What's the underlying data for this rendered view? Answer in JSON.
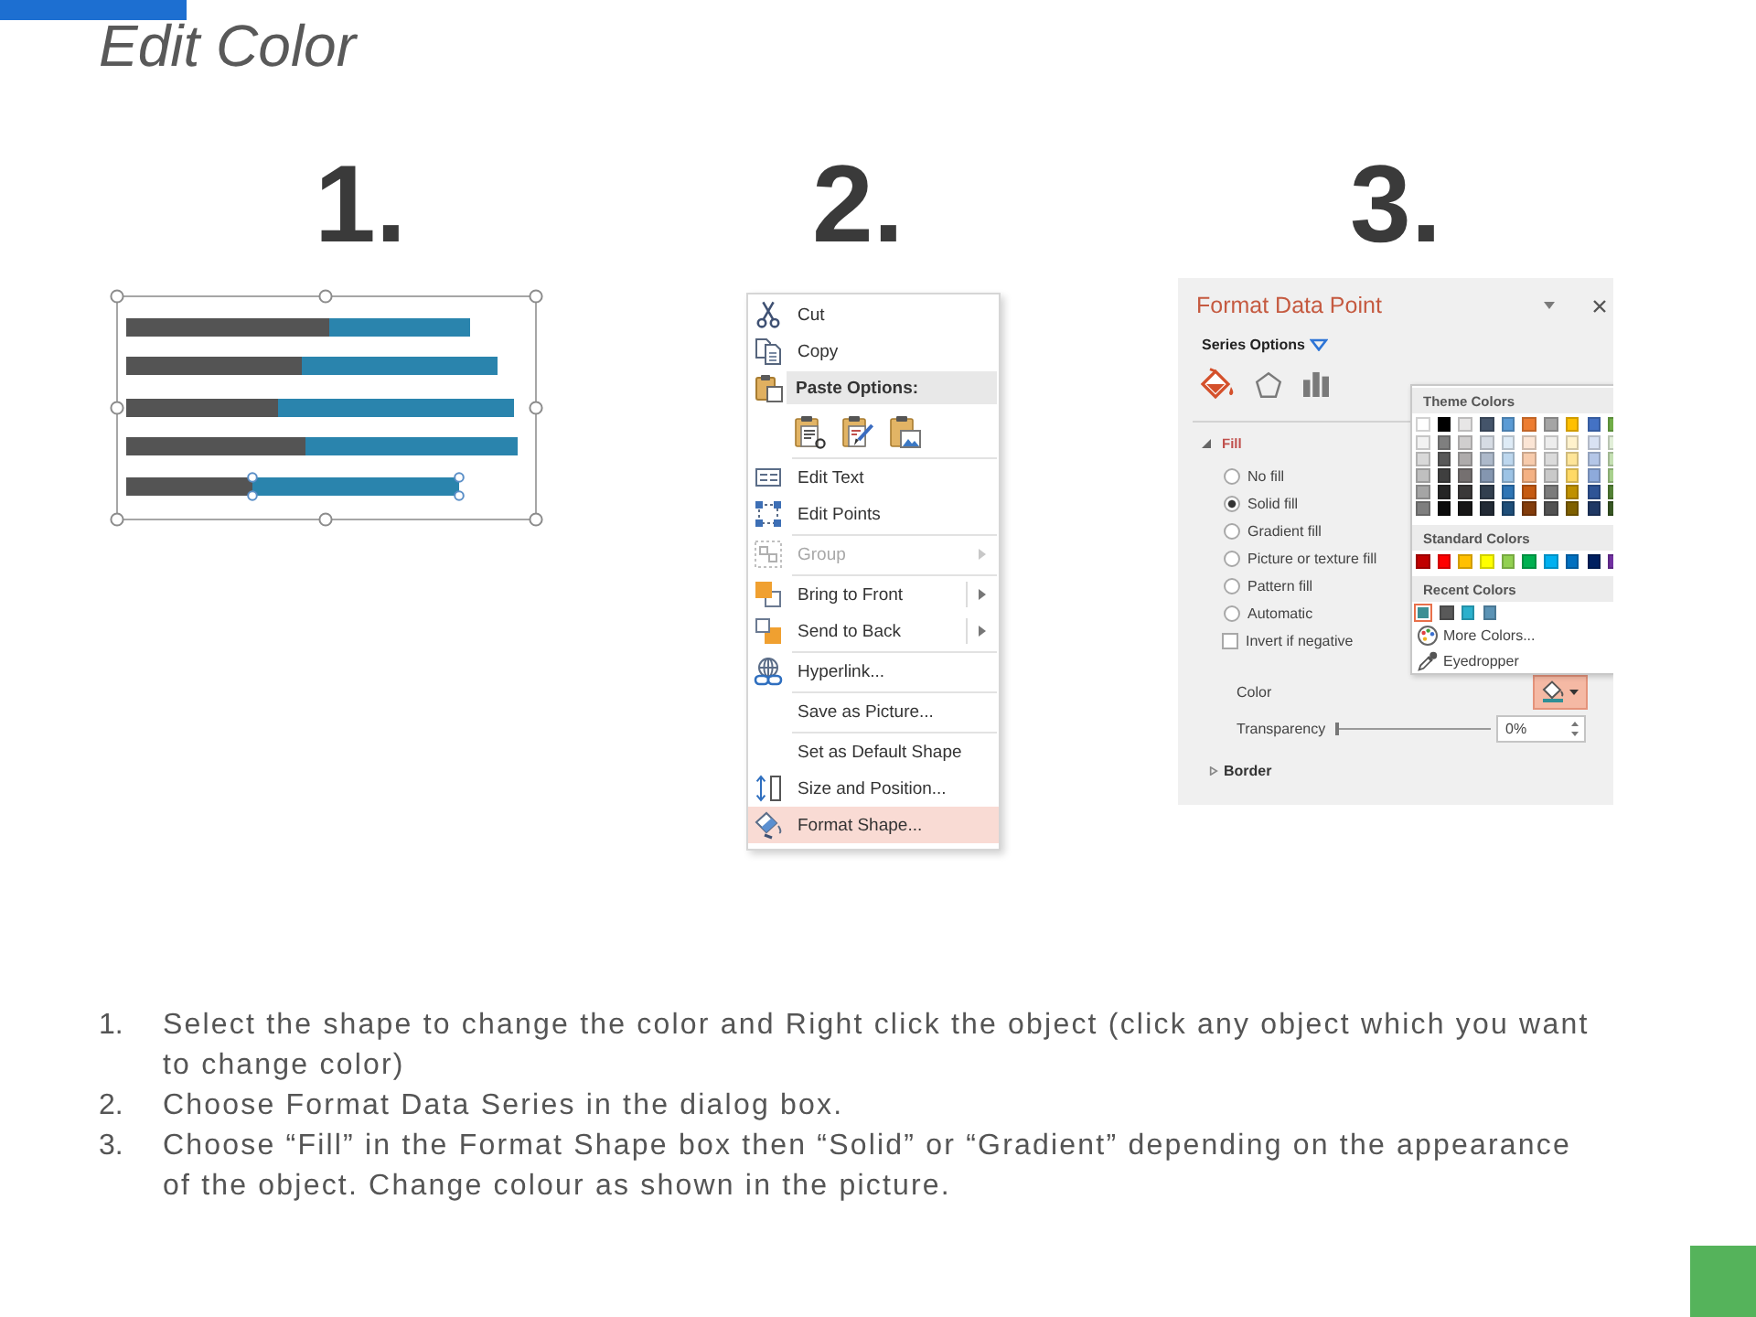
{
  "title": "Edit Color",
  "steps": [
    {
      "number": "1.",
      "kind": "chart"
    },
    {
      "number": "2.",
      "kind": "menu",
      "menu": {
        "items": [
          {
            "kind": "item",
            "label": "Cut",
            "disabled": false,
            "submenu": false,
            "selected": false
          },
          {
            "kind": "item",
            "label": "Copy",
            "disabled": false,
            "submenu": false,
            "selected": false
          },
          {
            "kind": "header",
            "label": "Paste Options:"
          },
          {
            "kind": "icon_row"
          },
          {
            "kind": "separator"
          },
          {
            "kind": "item",
            "label": "Edit Text",
            "disabled": false,
            "submenu": false,
            "selected": false
          },
          {
            "kind": "item",
            "label": "Edit Points",
            "disabled": false,
            "submenu": false,
            "selected": false
          },
          {
            "kind": "separator"
          },
          {
            "kind": "item",
            "label": "Group",
            "disabled": true,
            "submenu": true,
            "selected": false
          },
          {
            "kind": "separator"
          },
          {
            "kind": "item",
            "label": "Bring to Front",
            "disabled": false,
            "submenu": true,
            "selected": false
          },
          {
            "kind": "item",
            "label": "Send to Back",
            "disabled": false,
            "submenu": true,
            "selected": false
          },
          {
            "kind": "separator"
          },
          {
            "kind": "item",
            "label": "Hyperlink...",
            "disabled": false,
            "submenu": false,
            "selected": false
          },
          {
            "kind": "separator"
          },
          {
            "kind": "item",
            "label": "Save as Picture...",
            "disabled": false,
            "submenu": false,
            "selected": false
          },
          {
            "kind": "separator"
          },
          {
            "kind": "item",
            "label": "Set as Default Shape",
            "disabled": false,
            "submenu": false,
            "selected": false
          },
          {
            "kind": "item",
            "label": "Size and Position...",
            "disabled": false,
            "submenu": false,
            "selected": false
          },
          {
            "kind": "item",
            "label": "Format Shape...",
            "disabled": false,
            "submenu": false,
            "selected": true
          }
        ]
      }
    },
    {
      "number": "3.",
      "kind": "panel",
      "panel": {
        "title": "Format Data Point",
        "section": "Series Options",
        "tabs": [
          {
            "selected": true
          },
          {
            "selected": false
          },
          {
            "selected": false
          }
        ],
        "fill": {
          "label": "Fill",
          "expanded": true,
          "options": [
            {
              "label": "No fill",
              "selected": false
            },
            {
              "label": "Solid fill",
              "selected": true
            },
            {
              "label": "Gradient fill",
              "selected": false
            },
            {
              "label": "Picture or texture fill",
              "selected": false
            },
            {
              "label": "Pattern fill",
              "selected": false
            },
            {
              "label": "Automatic",
              "selected": false
            }
          ],
          "invert": {
            "label": "Invert if negative",
            "checked": false
          },
          "color": {
            "label": "Color",
            "pressed": true
          },
          "transparency": {
            "label": "Transparency",
            "level": 0,
            "value": "0%"
          }
        },
        "border": {
          "label": "Border",
          "expanded": false
        },
        "color_menu": {
          "theme": {
            "label": "Theme Colors",
            "colors": [
              {
                "color": "#ffffff"
              },
              {
                "color": "#000000"
              },
              {
                "color": "#e7e6e6"
              },
              {
                "color": "#44546a"
              },
              {
                "color": "#5b9bd5"
              },
              {
                "color": "#ed7d31"
              },
              {
                "color": "#a5a5a5"
              },
              {
                "color": "#ffc000"
              },
              {
                "color": "#4472c4"
              },
              {
                "color": "#70ad47"
              }
            ],
            "shades": [
              [
                {
                  "color": "#f2f2f2"
                },
                {
                  "color": "#7f7f7f"
                },
                {
                  "color": "#d0cece"
                },
                {
                  "color": "#d6dce4"
                },
                {
                  "color": "#deebf6"
                },
                {
                  "color": "#fbe5d5"
                },
                {
                  "color": "#ededed"
                },
                {
                  "color": "#fff2cc"
                },
                {
                  "color": "#d9e2f3"
                },
                {
                  "color": "#e2efd9"
                }
              ],
              [
                {
                  "color": "#d9d9d9"
                },
                {
                  "color": "#595959"
                },
                {
                  "color": "#aeabab"
                },
                {
                  "color": "#adb9ca"
                },
                {
                  "color": "#bdd7ee"
                },
                {
                  "color": "#f7cbac"
                },
                {
                  "color": "#dbdbdb"
                },
                {
                  "color": "#fee599"
                },
                {
                  "color": "#b4c6e7"
                },
                {
                  "color": "#c5e0b3"
                }
              ],
              [
                {
                  "color": "#bfbfbf"
                },
                {
                  "color": "#3f3f3f"
                },
                {
                  "color": "#757070"
                },
                {
                  "color": "#8496b0"
                },
                {
                  "color": "#9cc3e5"
                },
                {
                  "color": "#f4b183"
                },
                {
                  "color": "#c9c9c9"
                },
                {
                  "color": "#ffd965"
                },
                {
                  "color": "#8eaadb"
                },
                {
                  "color": "#a8d08d"
                }
              ],
              [
                {
                  "color": "#a5a5a5"
                },
                {
                  "color": "#262626"
                },
                {
                  "color": "#3a3838"
                },
                {
                  "color": "#323f4f"
                },
                {
                  "color": "#2e75b5"
                },
                {
                  "color": "#c55a11"
                },
                {
                  "color": "#7b7b7b"
                },
                {
                  "color": "#bf9000"
                },
                {
                  "color": "#2f5496"
                },
                {
                  "color": "#538135"
                }
              ],
              [
                {
                  "color": "#7f7f7f"
                },
                {
                  "color": "#0c0c0c"
                },
                {
                  "color": "#171616"
                },
                {
                  "color": "#222a35"
                },
                {
                  "color": "#1e4e79"
                },
                {
                  "color": "#833c0b"
                },
                {
                  "color": "#525252"
                },
                {
                  "color": "#7f6000"
                },
                {
                  "color": "#1f3864"
                },
                {
                  "color": "#375623"
                }
              ]
            ]
          },
          "standard": {
            "label": "Standard Colors",
            "colors": [
              {
                "color": "#c00000"
              },
              {
                "color": "#ff0000"
              },
              {
                "color": "#ffc000"
              },
              {
                "color": "#ffff00"
              },
              {
                "color": "#92d050"
              },
              {
                "color": "#00b050"
              },
              {
                "color": "#00b0f0"
              },
              {
                "color": "#0070c0"
              },
              {
                "color": "#002060"
              },
              {
                "color": "#7030a0"
              }
            ]
          },
          "recent": {
            "label": "Recent Colors",
            "colors": [
              {
                "color": "#3b8f94",
                "selected": true
              },
              {
                "color": "#595959",
                "selected": false
              },
              {
                "color": "#2bb0cc",
                "selected": false
              },
              {
                "color": "#5b93b5",
                "selected": false
              }
            ]
          },
          "actions": [
            {
              "label": "More Colors..."
            },
            {
              "label": "Eyedropper"
            }
          ]
        }
      }
    }
  ],
  "instructions": [
    {
      "number": "1.",
      "text": "Select the shape to change the color and Right click the object (click any object which you want to change color)"
    },
    {
      "number": "2.",
      "text": "Choose Format Data Series in the dialog box."
    },
    {
      "number": "3.",
      "text": "Choose “Fill” in the Format Shape box then “Solid” or “Gradient” depending on the appearance of the object. Change colour as shown in the picture."
    }
  ]
}
